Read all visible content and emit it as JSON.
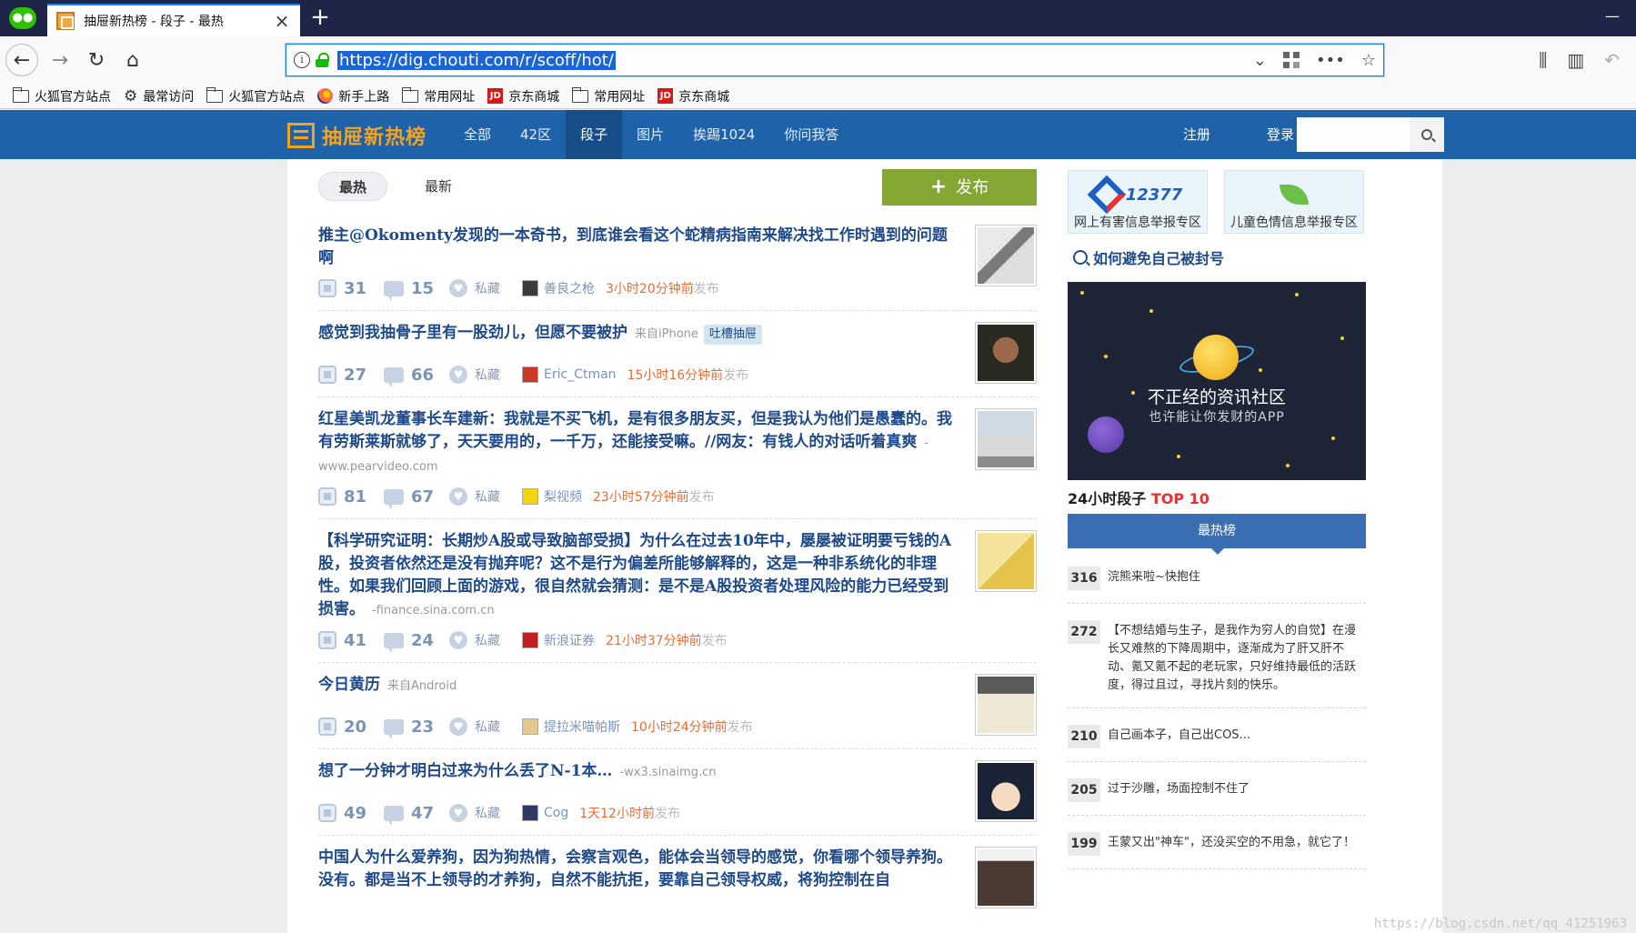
{
  "browser": {
    "tab_title": "抽屉新热榜 - 段子 - 最热",
    "url": "https://dig.chouti.com/r/scoff/hot/",
    "bookmarks": [
      {
        "icon": "folder-icon",
        "label": "火狐官方站点"
      },
      {
        "icon": "gear-icon",
        "label": "最常访问"
      },
      {
        "icon": "folder-icon",
        "label": "火狐官方站点"
      },
      {
        "icon": "firefox-icon",
        "label": "新手上路"
      },
      {
        "icon": "folder-icon",
        "label": "常用网址"
      },
      {
        "icon": "jd-icon",
        "label": "京东商城"
      },
      {
        "icon": "folder-icon",
        "label": "常用网址"
      },
      {
        "icon": "jd-icon",
        "label": "京东商城"
      }
    ]
  },
  "site": {
    "logo_text": "抽屉新热榜",
    "nav": [
      "全部",
      "42区",
      "段子",
      "图片",
      "挨踢1024",
      "你问我答"
    ],
    "nav_active": 2,
    "register": "注册",
    "login": "登录"
  },
  "main": {
    "subtabs": [
      "最热",
      "最新"
    ],
    "publish_label": "发布",
    "items": [
      {
        "title": "推主@Okomenty发现的一本奇书，到底谁会看这个蛇精病指南来解决找工作时遇到的问题啊",
        "source": "",
        "tag": "",
        "likes": "31",
        "comments": "15",
        "fav": "私藏",
        "author": "善良之枪",
        "time": "3小时20分钟前",
        "time_suffix": "发布"
      },
      {
        "title": "感觉到我抽骨子里有一股劲儿，但愿不要被护",
        "source": "来自iPhone",
        "tag": "吐槽抽屉",
        "likes": "27",
        "comments": "66",
        "fav": "私藏",
        "author": "Eric_Ctman",
        "time": "15小时16分钟前",
        "time_suffix": "发布"
      },
      {
        "title": "红星美凯龙董事长车建新：我就是不买飞机，是有很多朋友买，但是我认为他们是愚蠢的。我有劳斯莱斯就够了，天天要用的，一千万，还能接受嘛。//网友：有钱人的对话听着真爽",
        "source": "-www.pearvideo.com",
        "tag": "",
        "likes": "81",
        "comments": "67",
        "fav": "私藏",
        "author": "梨视频",
        "time": "23小时57分钟前",
        "time_suffix": "发布"
      },
      {
        "title": "【科学研究证明：长期炒A股或导致脑部受损】为什么在过去10年中，屡屡被证明要亏钱的A股，投资者依然还是没有抛弃呢？这不是行为偏差所能够解释的，这是一种非系统化的非理性。如果我们回顾上面的游戏，很自然就会猜测：是不是A股投资者处理风险的能力已经受到损害。",
        "source": "-finance.sina.com.cn",
        "tag": "",
        "likes": "41",
        "comments": "24",
        "fav": "私藏",
        "author": "新浪证券",
        "time": "21小时37分钟前",
        "time_suffix": "发布"
      },
      {
        "title": "今日黄历",
        "source": "来自Android",
        "tag": "",
        "likes": "20",
        "comments": "23",
        "fav": "私藏",
        "author": "提拉米喵帕斯",
        "time": "10小时24分钟前",
        "time_suffix": "发布"
      },
      {
        "title": "想了一分钟才明白过来为什么丢了N-1本…",
        "source": "-wx3.sinaimg.cn",
        "tag": "",
        "likes": "49",
        "comments": "47",
        "fav": "私藏",
        "author": "Cog",
        "time": "1天12小时前",
        "time_suffix": "发布"
      },
      {
        "title": "中国人为什么爱养狗，因为狗热情，会察言观色，能体会当领导的感觉，你看哪个领导养狗。没有。都是当不上领导的才养狗，自然不能抗拒，要靠自己领导权威，将狗控制在自",
        "source": "",
        "tag": "",
        "likes": "",
        "comments": "",
        "fav": "",
        "author": "",
        "time": "",
        "time_suffix": ""
      }
    ]
  },
  "side": {
    "report_cards": [
      {
        "logo": "12377",
        "label": "网上有害信息举报专区"
      },
      {
        "logo": "",
        "label": "儿童色情信息举报专区"
      }
    ],
    "avoid_ban": "如何避免自己被封号",
    "promo_title": "不正经的资讯社区",
    "promo_sub": "也许能让你发财的APP",
    "top10_prefix": "24小时段子 ",
    "top10_highlight": "TOP 10",
    "hot_tab": "最热榜",
    "hot_list": [
      {
        "count": "316",
        "text": "浣熊来啦~快抱住"
      },
      {
        "count": "272",
        "text": "【不想结婚与生子，是我作为穷人的自觉】在漫长又难熬的下降周期中，逐渐成为了肝又肝不动、氪又氪不起的老玩家，只好维持最低的活跃度，得过且过，寻找片刻的快乐。"
      },
      {
        "count": "210",
        "text": "自己画本子，自己出COS..."
      },
      {
        "count": "205",
        "text": "过于沙雕，场面控制不住了"
      },
      {
        "count": "199",
        "text": "王蒙又出\"神车\"，还没买空的不用急，就它了！"
      }
    ]
  },
  "watermark": "https://blog.csdn.net/qq_41251963"
}
